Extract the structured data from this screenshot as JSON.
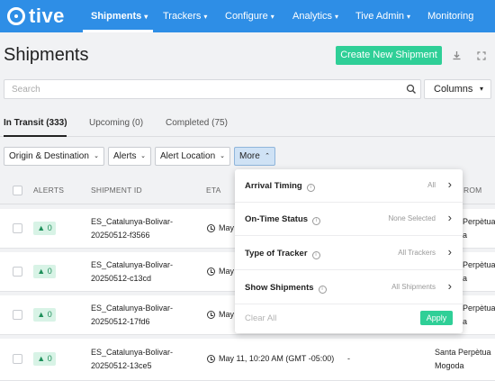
{
  "app": {
    "logo": "tive"
  },
  "nav": {
    "items": [
      {
        "label": "Shipments",
        "caret": "▾"
      },
      {
        "label": "Trackers",
        "caret": "▾"
      },
      {
        "label": "Configure",
        "caret": "▾"
      },
      {
        "label": "Analytics",
        "caret": "▾"
      },
      {
        "label": "Tive Admin",
        "caret": "▾"
      },
      {
        "label": "Monitoring",
        "caret": ""
      }
    ]
  },
  "header": {
    "title": "Shipments",
    "create_button": "Create New Shipment",
    "download_icon": "download-icon",
    "expand_icon": "expand-icon"
  },
  "search": {
    "placeholder": "Search",
    "value": "",
    "columns_label": "Columns",
    "columns_caret": "▾"
  },
  "tabs": [
    {
      "label": "In Transit (333)"
    },
    {
      "label": "Upcoming (0)"
    },
    {
      "label": "Completed (75)"
    }
  ],
  "filters": [
    {
      "label": "Origin & Destination",
      "caret": "⌄"
    },
    {
      "label": "Alerts",
      "caret": "⌄"
    },
    {
      "label": "Alert Location",
      "caret": "⌄"
    },
    {
      "label": "More",
      "caret": "⌃"
    }
  ],
  "table": {
    "headers": {
      "alerts": "ALERTS",
      "shipment_id": "SHIPMENT ID",
      "eta": "ETA",
      "from": "ROM"
    },
    "rows": [
      {
        "alerts": "0",
        "id_line1": "ES_Catalunya-Bolivar-",
        "id_line2": "20250512-f3566",
        "eta": "May",
        "from_line1": "Perpètua",
        "from_line2": "a"
      },
      {
        "alerts": "0",
        "id_line1": "ES_Catalunya-Bolivar-",
        "id_line2": "20250512-c13cd",
        "eta": "May",
        "from_line1": "Perpètua",
        "from_line2": "a"
      },
      {
        "alerts": "0",
        "id_line1": "ES_Catalunya-Bolivar-",
        "id_line2": "20250512-17fd6",
        "eta": "May",
        "from_line1": "Perpètua",
        "from_line2": "a"
      },
      {
        "alerts": "0",
        "id_line1": "ES_Catalunya-Bolivar-",
        "id_line2": "20250512-13ce5",
        "eta": "May 11, 10:20 AM (GMT -05:00)",
        "dash": "-",
        "from_line1": "Santa Perpètua",
        "from_line2": "Mogoda"
      }
    ],
    "alert_arrow": "▲"
  },
  "more_menu": {
    "items": [
      {
        "label": "Arrival Timing",
        "value": "All"
      },
      {
        "label": "On-Time Status",
        "value": "None Selected"
      },
      {
        "label": "Type of Tracker",
        "value": "All Trackers"
      },
      {
        "label": "Show Shipments",
        "value": "All Shipments"
      }
    ],
    "info_glyph": "i",
    "chevron": "›",
    "clear_label": "Clear All",
    "apply_label": "Apply"
  },
  "colors": {
    "nav": "#2e8ee6",
    "accent_green": "#2fcf97",
    "badge_bg": "#d8f3e6",
    "badge_text": "#1e8f5a"
  }
}
